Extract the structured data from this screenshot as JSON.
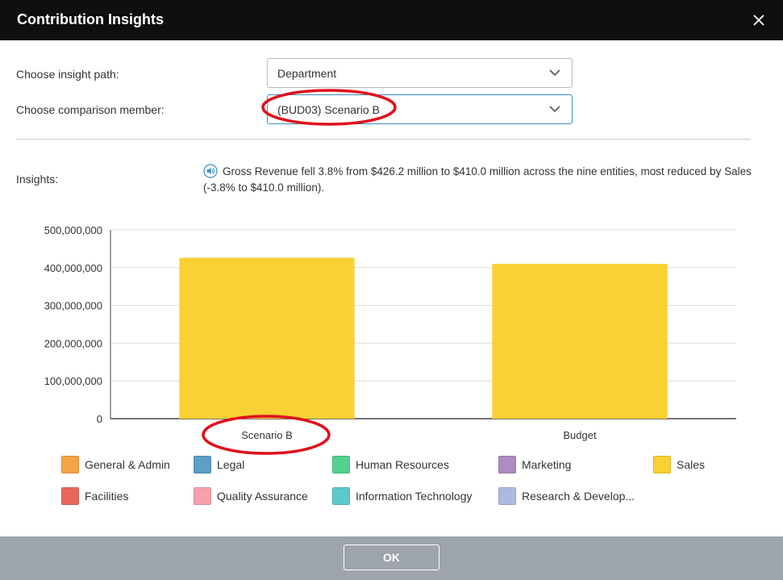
{
  "dialog": {
    "title": "Contribution Insights",
    "ok_label": "OK"
  },
  "form": {
    "insight_path_label": "Choose insight path:",
    "insight_path_value": "Department",
    "comparison_label": "Choose comparison member:",
    "comparison_value": "(BUD03) Scenario B",
    "insights_label": "Insights:",
    "insights_text": "Gross Revenue fell 3.8% from $426.2 million to $410.0 million across the nine entities, most reduced by Sales (-3.8% to $410.0 million)."
  },
  "chart_data": {
    "type": "bar",
    "stacked": true,
    "categories": [
      "Scenario B",
      "Budget"
    ],
    "series": [
      {
        "name": "Sales",
        "color": "#f9d132",
        "values": [
          426200000,
          410000000
        ]
      }
    ],
    "y_ticks": [
      "0",
      "100,000,000",
      "200,000,000",
      "300,000,000",
      "400,000,000",
      "500,000,000"
    ],
    "ylim": [
      0,
      500000000
    ],
    "grid": true,
    "legend_position": "bottom"
  },
  "legend": [
    {
      "label": "General & Admin",
      "color": "#f7a348"
    },
    {
      "label": "Legal",
      "color": "#5c9ec7"
    },
    {
      "label": "Human Resources",
      "color": "#55d08e"
    },
    {
      "label": "Marketing",
      "color": "#ae8ac2"
    },
    {
      "label": "Sales",
      "color": "#f9d132"
    },
    {
      "label": "Facilities",
      "color": "#e8675a"
    },
    {
      "label": "Quality Assurance",
      "color": "#f7a1ad"
    },
    {
      "label": "Information Technology",
      "color": "#5ccacc"
    },
    {
      "label": "Research & Develop..."
    }
  ],
  "colors": {
    "titlebar": "#0f0f0f",
    "footer": "#9ea4ad",
    "annotation": "#e0101a",
    "research_color": "#adbadf"
  }
}
